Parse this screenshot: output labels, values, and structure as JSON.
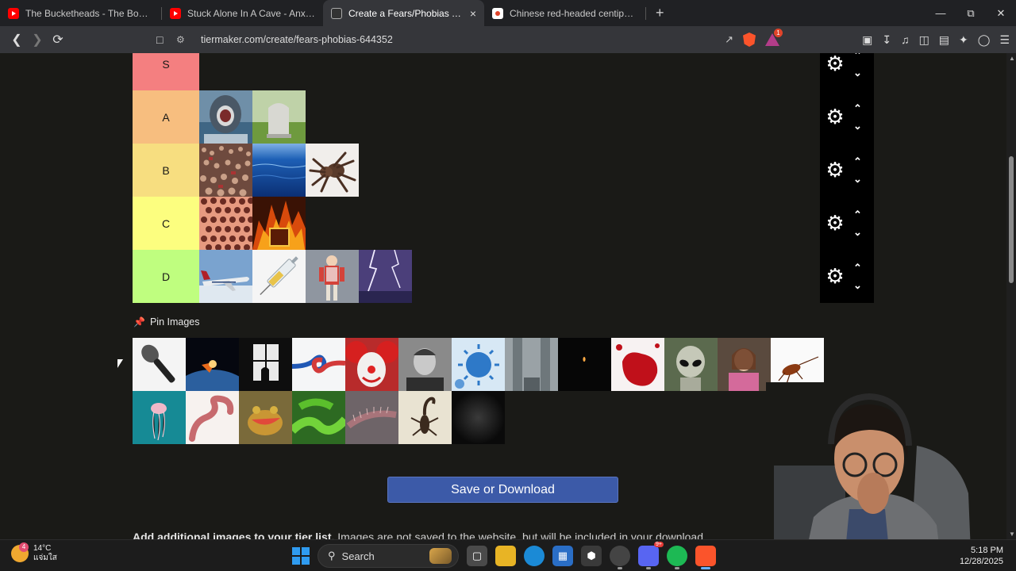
{
  "browser": {
    "tabs": [
      {
        "title": "The Bucketheads - The Bomb [These",
        "favicon": "youtube-icon",
        "active": false
      },
      {
        "title": "Stuck Alone In A Cave - Anxiety Warr",
        "favicon": "youtube-icon",
        "active": false
      },
      {
        "title": "Create a Fears/Phobias Tier List",
        "favicon": "tiermaker-icon",
        "active": true,
        "close": "×"
      },
      {
        "title": "Chinese red-headed centipede - Brav",
        "favicon": "brave-icon",
        "active": false
      }
    ],
    "new_tab": "+",
    "url": "tiermaker.com/create/fears-phobias-644352",
    "rewards_badge": "1"
  },
  "tier_list": {
    "tiers": [
      {
        "label": "S",
        "color": "#f47f80",
        "items": []
      },
      {
        "label": "A",
        "color": "#f7be7f",
        "items": [
          "shark",
          "gravestone"
        ]
      },
      {
        "label": "B",
        "color": "#f7de80",
        "items": [
          "crowd",
          "deep-ocean",
          "tarantula"
        ]
      },
      {
        "label": "C",
        "color": "#fcfe7f",
        "items": [
          "holes-trypophobia",
          "fire"
        ]
      },
      {
        "label": "D",
        "color": "#bffe7f",
        "items": [
          "airplane",
          "syringe",
          "puppet-clown",
          "lightning"
        ]
      }
    ],
    "pin_label": "Pin Images",
    "pool_items": [
      "microphone",
      "asteroid-earth",
      "dark-window",
      "knot-rope",
      "clown",
      "portrait-man",
      "virus",
      "height-view",
      "candle-dark",
      "blood",
      "alien",
      "scared-girl",
      "cockroach",
      "jellyfish",
      "worm",
      "frog",
      "green-snake",
      "centipede",
      "scorpion",
      "darkness"
    ]
  },
  "save_button_label": "Save or Download",
  "additional_text_bold": "Add additional images to your tier list.",
  "additional_text": " Images are not saved to the website, but will be included in your download.",
  "taskbar": {
    "weather_temp": "14°C",
    "weather_desc": "แจ่มใส",
    "weather_badge": "4",
    "search_label": "Search",
    "discord_badge": "9+",
    "time": "5:18 PM",
    "date": "12/28/2025"
  }
}
